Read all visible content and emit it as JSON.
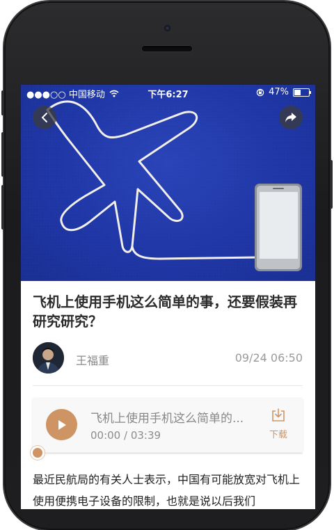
{
  "status_bar": {
    "carrier": "●●●○○ 中国移动",
    "time": "下午6:27",
    "battery_percent": "47%",
    "battery_level": 0.47
  },
  "header": {
    "back_icon": "chevron-left-icon",
    "share_icon": "share-arrow-icon"
  },
  "article": {
    "title": "飞机上使用手机这么简单的事，还要假装再研究研究？",
    "author": "王福重",
    "date": "09/24 06:50",
    "body": "最近民航局的有关人士表示，中国有可能放宽对飞机上使用便携电子设备的限制，也就是说以后我们"
  },
  "audio": {
    "title": "飞机上使用手机这么简单的...",
    "current_time": "00:00",
    "separator": " / ",
    "duration": "03:39",
    "download_label": "下载",
    "progress": 0.0
  },
  "colors": {
    "accent": "#cf9464",
    "hero_bg": "#1f36a6"
  }
}
